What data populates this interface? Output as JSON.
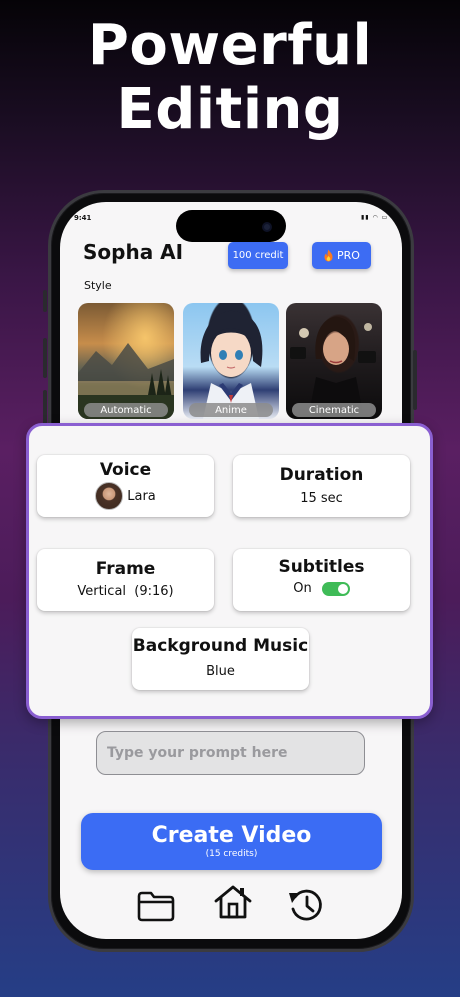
{
  "headline": {
    "line1": "Powerful",
    "line2": "Editing"
  },
  "status_bar": {
    "time": "9:41",
    "icons": "▮▮ ◠ ▭"
  },
  "app": {
    "brand": "Sopha AI",
    "credit_label": "100 credit",
    "pro_label": "PRO",
    "pro_icon": "fire-icon"
  },
  "style_section": {
    "label": "Style",
    "cards": [
      {
        "label": "Automatic"
      },
      {
        "label": "Anime"
      },
      {
        "label": "Cinematic"
      }
    ]
  },
  "settings": {
    "voice": {
      "title": "Voice",
      "value": "Lara"
    },
    "duration": {
      "title": "Duration",
      "value": "15 sec"
    },
    "frame": {
      "title": "Frame",
      "value": "Vertical  (9:16)"
    },
    "subtitles": {
      "title": "Subtitles",
      "value": "On",
      "enabled": true
    },
    "music": {
      "title": "Background Music",
      "value": "Blue"
    }
  },
  "prompt": {
    "placeholder": "Type your prompt here",
    "value": ""
  },
  "create": {
    "label": "Create Video",
    "sub": "(15 credits)"
  },
  "bottom_nav": [
    {
      "icon": "folder-icon"
    },
    {
      "icon": "home-icon"
    },
    {
      "icon": "history-icon"
    }
  ],
  "colors": {
    "accent_blue": "#3b6cf4",
    "panel_border": "#8a5fd1",
    "toggle_on": "#3fbb57"
  }
}
